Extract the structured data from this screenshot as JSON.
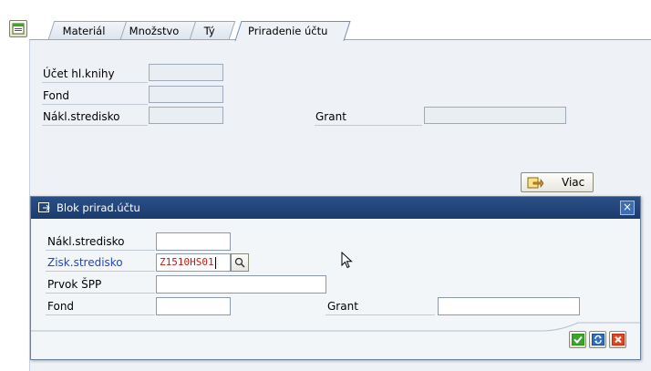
{
  "tabs": [
    {
      "label": "Materiál"
    },
    {
      "label": "Množstvo"
    },
    {
      "label": "Tý"
    },
    {
      "label": "Priradenie účtu"
    }
  ],
  "form": {
    "gl_account_label": "Účet hl.knihy",
    "gl_account_value": "",
    "fund_label": "Fond",
    "fund_value": "",
    "cost_center_label": "Nákl.stredisko",
    "cost_center_value": "",
    "grant_label": "Grant",
    "grant_value": "",
    "more_label": "Viac"
  },
  "dialog": {
    "title": "Blok prirad.účtu",
    "close_glyph": "×",
    "cost_center_label": "Nákl.stredisko",
    "cost_center_value": "",
    "profit_center_label": "Zisk.stredisko",
    "profit_center_value": "Z1510HS01",
    "wbs_label": "Prvok ŠPP",
    "wbs_value": "",
    "fund_label": "Fond",
    "fund_value": "",
    "grant_label": "Grant",
    "grant_value": "",
    "profit_center_label_color": "#2045c8"
  },
  "colors": {
    "titlebar": "#1f4275",
    "confirm_green": "#2f8f1f",
    "cancel_red": "#c62a10"
  }
}
